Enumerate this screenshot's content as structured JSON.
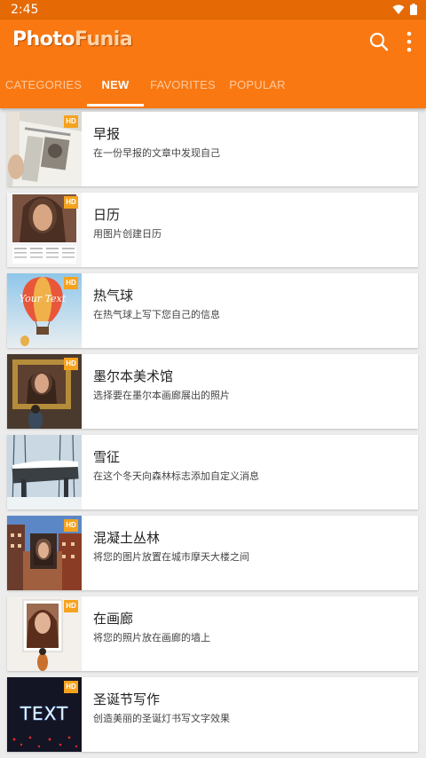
{
  "status": {
    "time": "2:45"
  },
  "app": {
    "logo_part1": "Photo",
    "logo_part2": "Funia"
  },
  "tabs": [
    {
      "label": "CATEGORIES"
    },
    {
      "label": "NEW",
      "active": true
    },
    {
      "label": "FAVORITES"
    },
    {
      "label": "POPULAR"
    }
  ],
  "items": [
    {
      "title": "早报",
      "desc": "在一份早报的文章中发现自己",
      "badge": "HD"
    },
    {
      "title": "日历",
      "desc": "用图片创建日历",
      "badge": "HD"
    },
    {
      "title": "热气球",
      "desc": "在热气球上写下您自己的信息",
      "badge": "HD"
    },
    {
      "title": "墨尔本美术馆",
      "desc": "选择要在墨尔本画廊展出的照片",
      "badge": "HD"
    },
    {
      "title": "雪征",
      "desc": "在这个冬天向森林标志添加自定义消息",
      "badge": "HD"
    },
    {
      "title": "混凝土丛林",
      "desc": "将您的图片放置在城市摩天大楼之间",
      "badge": "HD"
    },
    {
      "title": "在画廊",
      "desc": "将您的照片放在画廊的墙上",
      "badge": "HD"
    },
    {
      "title": "圣诞节写作",
      "desc": "创造美丽的圣诞灯书写文字效果",
      "badge": "HD"
    }
  ],
  "thumb_texts": {
    "balloon": "Your Text",
    "christmas": "TEXT"
  },
  "colors": {
    "status_bar": "#e56a06",
    "app_bar": "#f97811",
    "badge": "#f6a21d"
  }
}
